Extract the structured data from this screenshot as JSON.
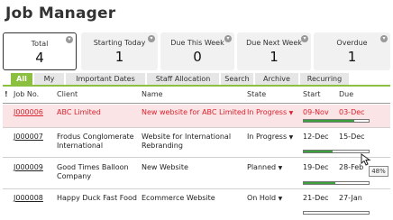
{
  "page": {
    "title": "Job Manager"
  },
  "stats": [
    {
      "label": "Total",
      "value": "4",
      "active": true
    },
    {
      "label": "Starting Today",
      "value": "1"
    },
    {
      "label": "Due This Week",
      "value": "0"
    },
    {
      "label": "Due Next Week",
      "value": "1"
    },
    {
      "label": "Overdue",
      "value": "1"
    }
  ],
  "tabs": [
    "All",
    "My",
    "Important Dates",
    "Staff Allocation",
    "Search",
    "Archive",
    "Recurring"
  ],
  "table": {
    "columns": {
      "flag": "!",
      "job_no": "Job No.",
      "client": "Client",
      "name": "Name",
      "state": "State",
      "start": "Start",
      "due": "Due"
    },
    "rows": [
      {
        "job_no": "J000006",
        "client": "ABC Limited",
        "name": "New website for ABC Limited",
        "state": "In Progress",
        "start": "09-Nov",
        "due": "03-Dec",
        "progress": 0.78,
        "highlight": true
      },
      {
        "job_no": "J000007",
        "client": "Frodus Conglomerate International",
        "name": "Website for International Rebranding",
        "state": "In Progress",
        "start": "12-Dec",
        "due": "15-Dec",
        "progress": 0.45
      },
      {
        "job_no": "J000009",
        "client": "Good Times Balloon Company",
        "name": "New Website",
        "state": "Planned",
        "start": "19-Dec",
        "due": "28-Feb",
        "progress": 0.48
      },
      {
        "job_no": "J000008",
        "client": "Happy Duck Fast Food",
        "name": "Ecommerce Website",
        "state": "On Hold",
        "start": "21-Dec",
        "due": "27-Jan",
        "progress": 0.0
      }
    ]
  },
  "tooltip": {
    "text": "48%"
  },
  "icons": {
    "stat_dropdown": "chevron-down-icon",
    "state_caret": "caret-down-icon",
    "cursor": "mouse-pointer-icon"
  },
  "colors": {
    "accent": "#8bbf3f",
    "overdue_text": "#d9232e",
    "overdue_bg": "#fbe4e6",
    "progress": "#3aa13a"
  }
}
